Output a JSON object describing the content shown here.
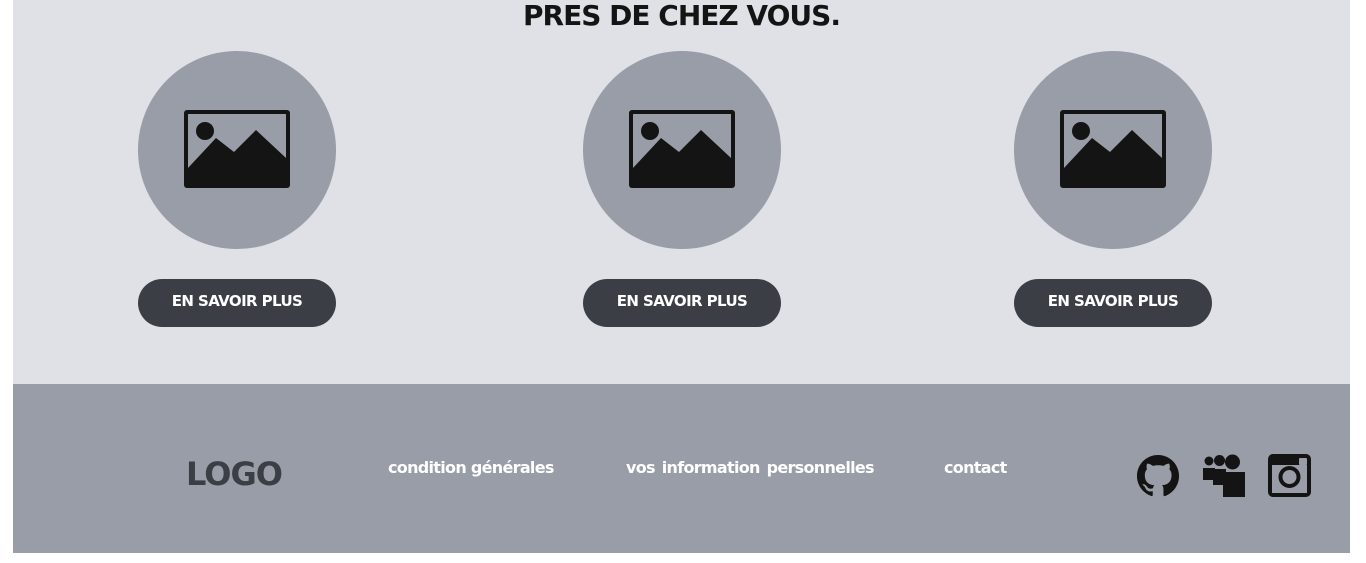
{
  "section": {
    "title": "PRES DE CHEZ VOUS."
  },
  "cards": [
    {
      "image_icon": "image-placeholder-icon",
      "button_label": "EN SAVOIR PLUS"
    },
    {
      "image_icon": "image-placeholder-icon",
      "button_label": "EN SAVOIR PLUS"
    },
    {
      "image_icon": "image-placeholder-icon",
      "button_label": "EN SAVOIR PLUS"
    }
  ],
  "footer": {
    "logo": "LOGO",
    "links": [
      {
        "label": "condition générales"
      },
      {
        "label": "vos information personnelles"
      },
      {
        "label": "contact"
      }
    ],
    "social_icons": [
      "github-icon",
      "myspace-icon",
      "instagram-icon"
    ]
  },
  "colors": {
    "section_bg": "#dfe1e6",
    "circle_bg": "#989da7",
    "button_bg": "#3b3f45",
    "footer_bg": "#989da7",
    "text_dark": "#141414",
    "text_light": "#ffffff"
  }
}
